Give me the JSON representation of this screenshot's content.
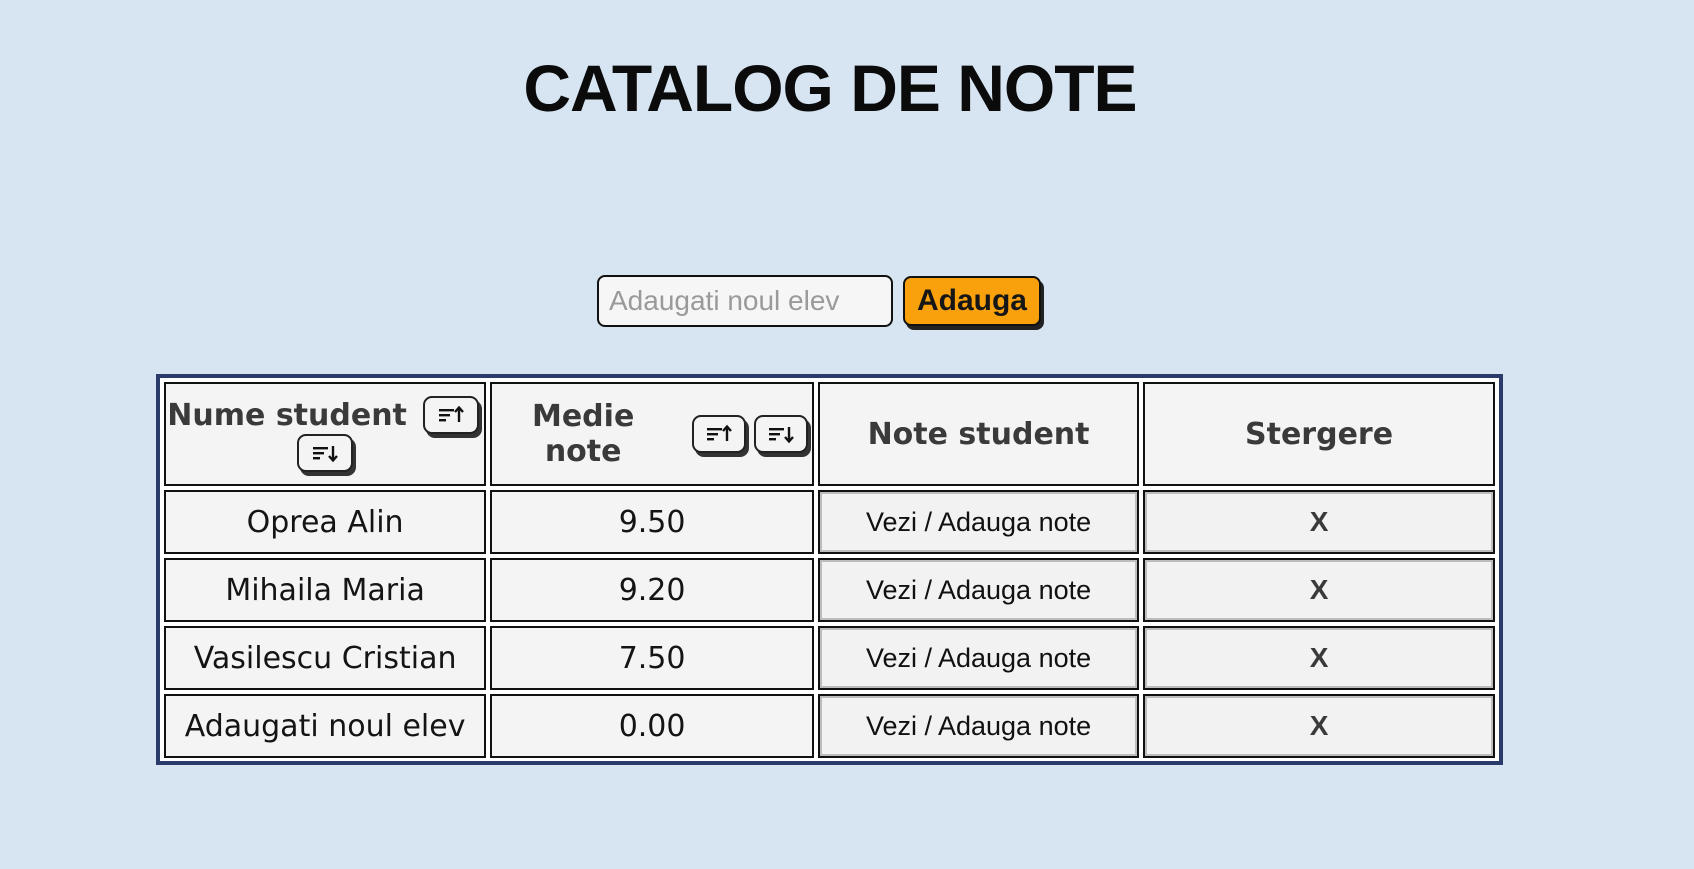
{
  "page": {
    "title": "CATALOG DE NOTE"
  },
  "add_form": {
    "placeholder": "Adaugati noul elev",
    "value": "",
    "button_label": "Adauga",
    "button_color": "#f8a10d"
  },
  "table": {
    "headers": {
      "name": "Nume student",
      "average": "Medie note",
      "grades": "Note student",
      "delete": "Stergere"
    },
    "sort_icons": {
      "ascending": "sort-ascending-icon",
      "descending": "sort-descending-icon"
    },
    "rows": [
      {
        "name": "Oprea Alin",
        "average": "9.50",
        "grades_label": "Vezi / Adauga note",
        "delete_label": "X"
      },
      {
        "name": "Mihaila Maria",
        "average": "9.20",
        "grades_label": "Vezi / Adauga note",
        "delete_label": "X"
      },
      {
        "name": "Vasilescu Cristian",
        "average": "7.50",
        "grades_label": "Vezi / Adauga note",
        "delete_label": "X"
      },
      {
        "name": "Adaugati noul elev",
        "average": "0.00",
        "grades_label": "Vezi / Adauga note",
        "delete_label": "X"
      }
    ]
  },
  "colors": {
    "background": "#d7e4f2",
    "table_border": "#2a3a6a",
    "cell_background": "#f4f4f4"
  }
}
